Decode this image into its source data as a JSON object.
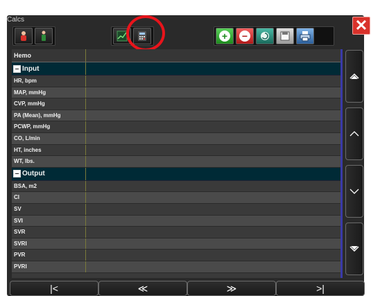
{
  "window": {
    "title": "Calcs",
    "close_glyph": "✕"
  },
  "toolbar": {
    "left_group": [
      "patient-icon",
      "person-standing-icon"
    ],
    "mid_group": [
      "chart-icon",
      "calculator-icon"
    ],
    "right_group": [
      "add-icon",
      "remove-icon",
      "reset-icon",
      "save-icon",
      "print-icon"
    ],
    "add_glyph": "+",
    "remove_glyph": "−"
  },
  "grid": {
    "header": "Hemo",
    "input_section": "Input",
    "input_rows": [
      "HR, bpm",
      "MAP, mmHg",
      "CVP, mmHg",
      "PA (Mean), mmHg",
      "PCWP, mmHg",
      "CO, L/min",
      "HT, inches",
      "WT, lbs."
    ],
    "output_section": "Output",
    "output_rows": [
      "BSA, m2",
      "CI",
      "SV",
      "SVI",
      "SVR",
      "SVRI",
      "PVR",
      "PVRI"
    ]
  },
  "scrollbar": [
    "page-up-icon",
    "scroll-up-icon",
    "scroll-down-icon",
    "page-down-icon"
  ],
  "pager": {
    "first": "|<",
    "prev": "≪",
    "next": "≫",
    "last": ">|"
  },
  "colors": {
    "highlight": "#e8141b",
    "section_bg": "#002a36",
    "close_bg": "#d9322b"
  }
}
